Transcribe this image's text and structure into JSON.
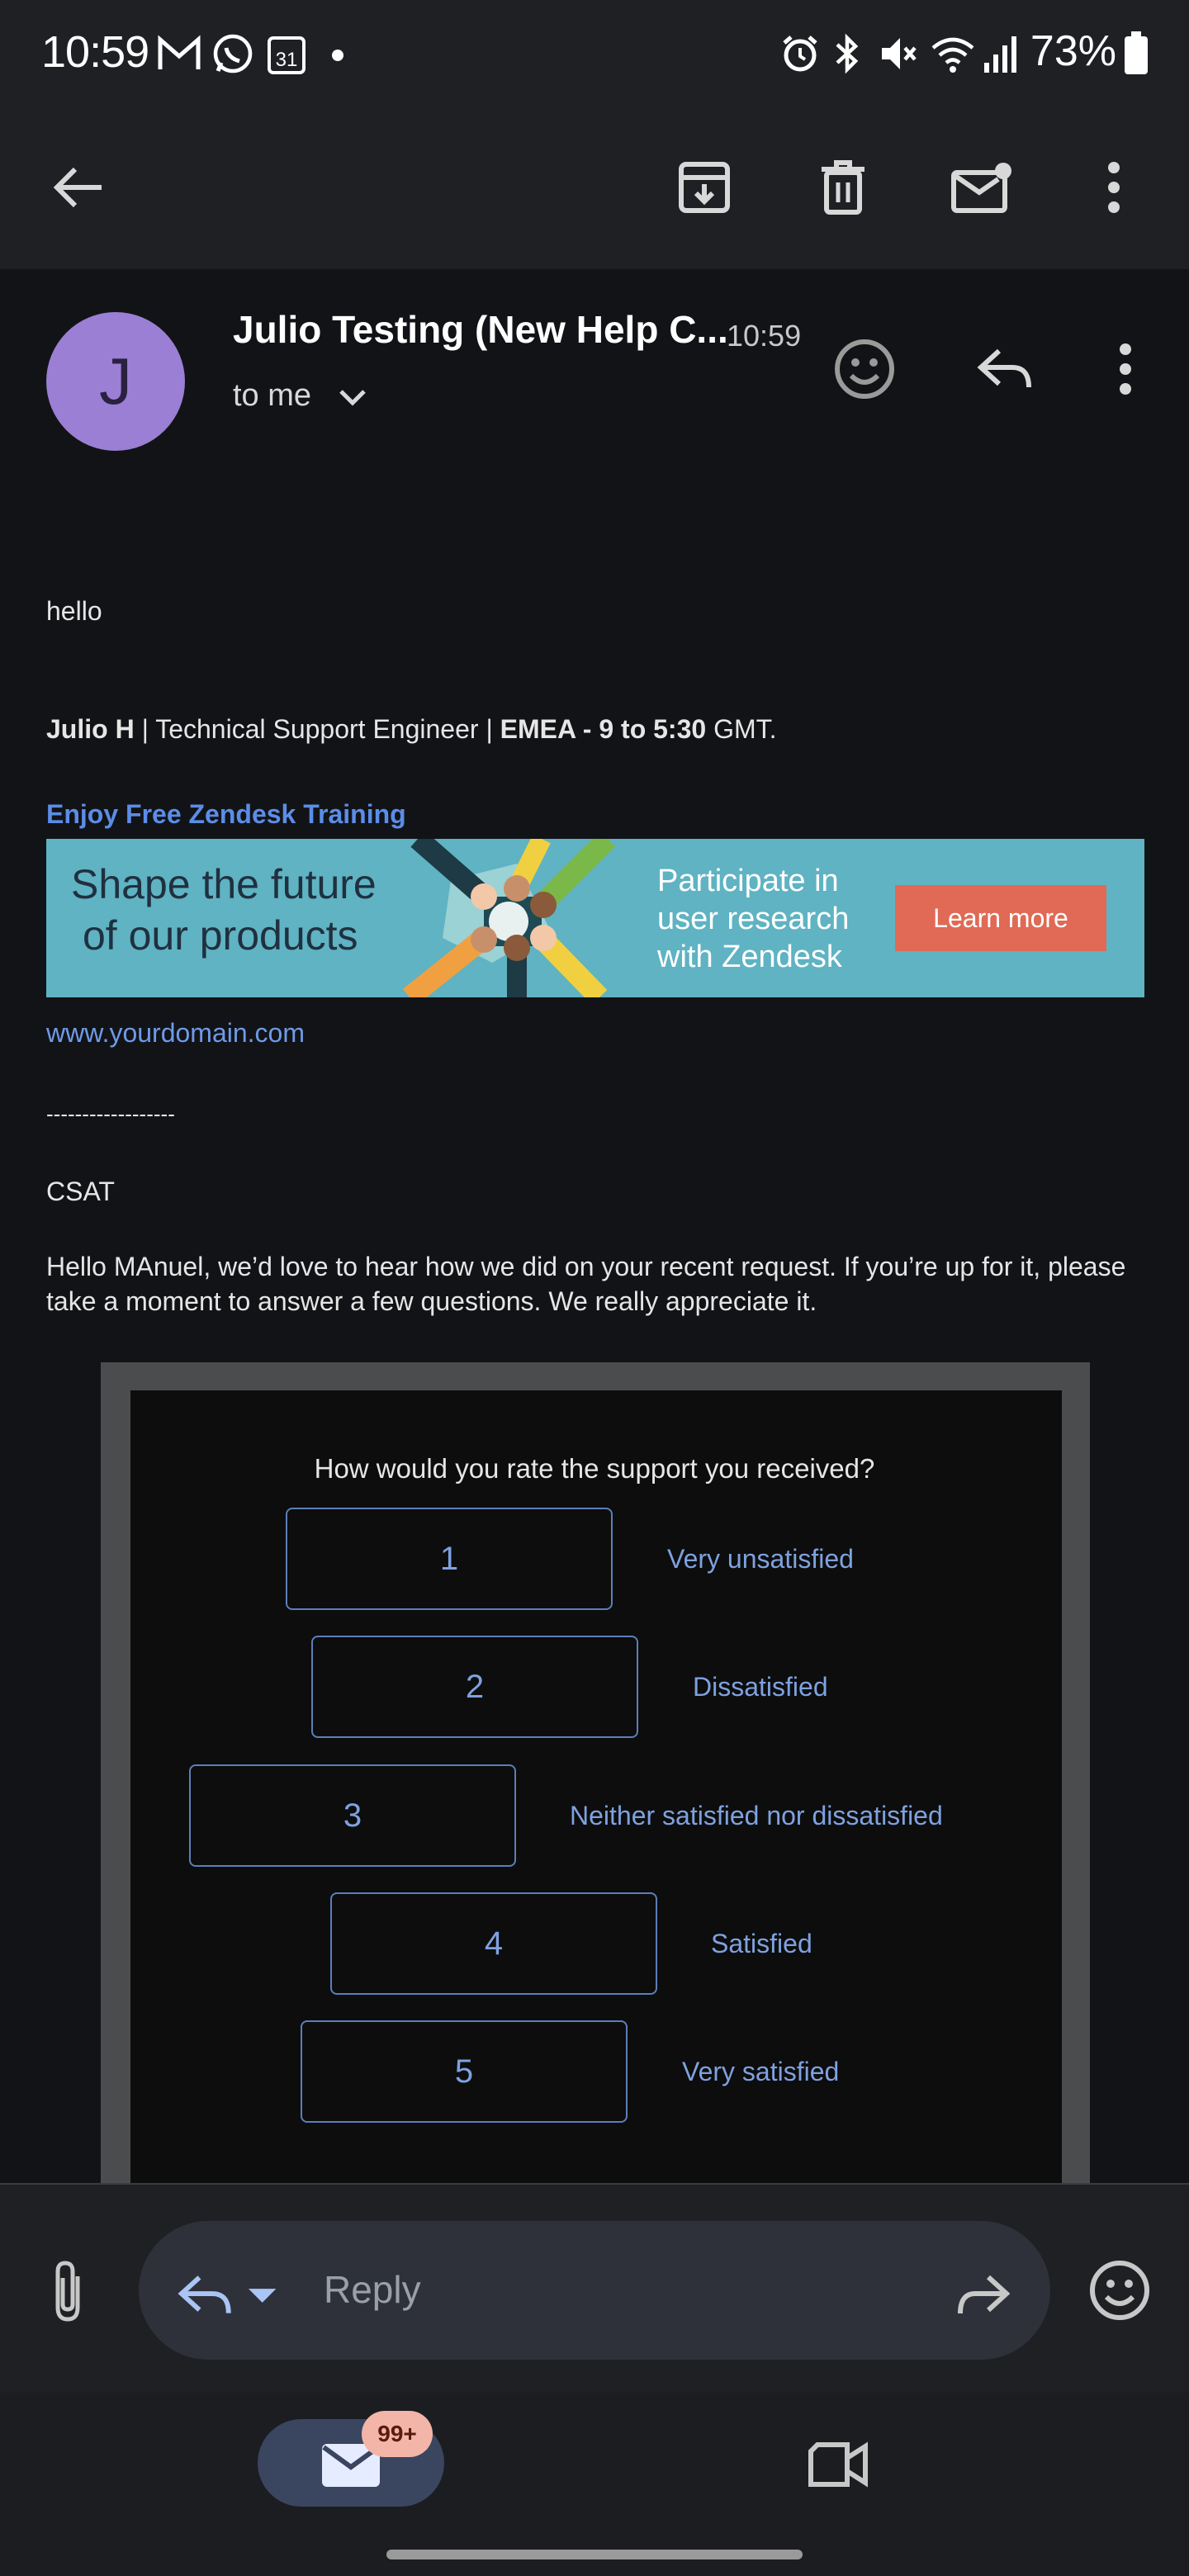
{
  "status_bar": {
    "time": "10:59",
    "battery": "73%",
    "icons": [
      "gmail-icon",
      "whatsapp-icon",
      "calendar-icon",
      "dot-icon",
      "alarm-icon",
      "bluetooth-icon",
      "mute-icon",
      "wifi-icon",
      "signal-icon",
      "battery-icon"
    ],
    "calendar_day": "31"
  },
  "toolbar": {
    "back_icon": "back-arrow-icon",
    "archive_icon": "archive-icon",
    "delete_icon": "trash-icon",
    "mark_unread_icon": "mark-unread-icon",
    "more_icon": "more-vert-icon"
  },
  "header": {
    "avatar_letter": "J",
    "avatar_color": "#9b7fd4",
    "sender": "Julio Testing (New Help C...",
    "time": "10:59",
    "to": "to me"
  },
  "body": {
    "greeting": "hello",
    "signature": {
      "name": "Julio H",
      "sep1": " | Technical Support Engineer | ",
      "region": "EMEA - 9 to 5:30",
      "tz": " GMT."
    },
    "training_link": "Enjoy Free Zendesk Training",
    "banner": {
      "left_line1": "Shape the future",
      "left_line2": "of our products",
      "right_line1": "Participate in",
      "right_line2": "user research",
      "right_line3": "with Zendesk",
      "button": "Learn more"
    },
    "domain_link": "www.yourdomain.com",
    "divider": "------------------",
    "csat_label": "CSAT",
    "intro": "Hello MAnuel, we’d love to hear how we did on your recent request. If you’re up for it, please take a moment to answer a few questions. We really appreciate it."
  },
  "survey": {
    "question": "How would you rate the support you received?",
    "options": [
      {
        "value": "1",
        "label": "Very unsatisfied"
      },
      {
        "value": "2",
        "label": "Dissatisfied"
      },
      {
        "value": "3",
        "label": "Neither satisfied nor dissatisfied"
      },
      {
        "value": "4",
        "label": "Satisfied"
      },
      {
        "value": "5",
        "label": "Very satisfied"
      }
    ]
  },
  "reply_bar": {
    "placeholder": "Reply"
  },
  "bottom_nav": {
    "mail_badge": "99+"
  },
  "colors": {
    "background": "#121316",
    "link": "#6f9ae8",
    "accent_button": "#e06a55"
  }
}
